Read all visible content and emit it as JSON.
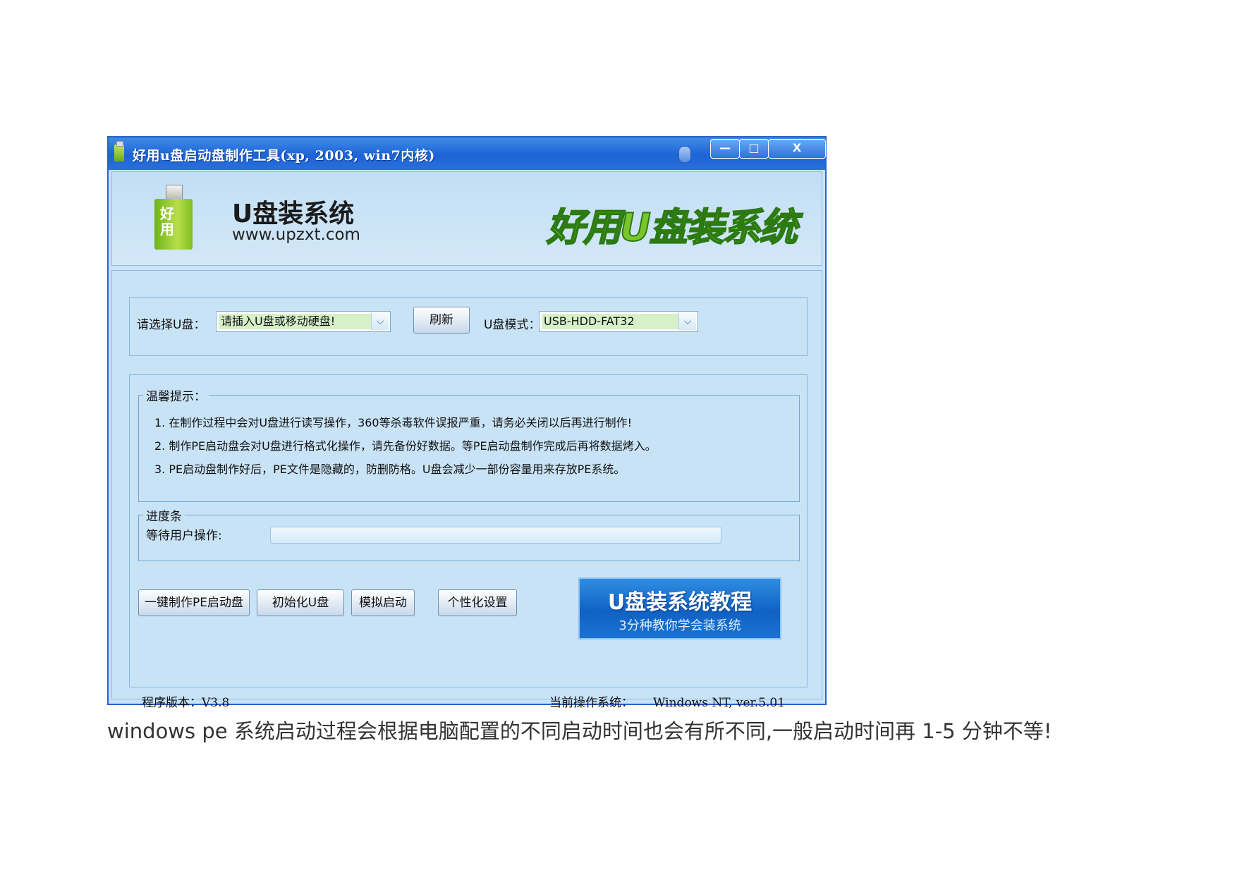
{
  "window": {
    "title": "好用u盘启动盘制作工具(xp, 2003, win7内核)",
    "min_label": "—",
    "max_label": "□",
    "close_label": "X"
  },
  "header": {
    "logo_text": "好用",
    "brand_name": "U盘装系统",
    "brand_url": "www.upzxt.com",
    "slogan": "好用U盘装系统"
  },
  "select": {
    "disk_label": "请选择U盘：",
    "disk_value": "请插入U盘或移动硬盘!",
    "refresh_label": "刷新",
    "mode_label": "U盘模式：",
    "mode_value": "USB-HDD-FAT32"
  },
  "tips": {
    "title": "温馨提示：",
    "items": [
      "1. 在制作过程中会对U盘进行读写操作，360等杀毒软件误报严重，请务必关闭以后再进行制作!",
      "2. 制作PE启动盘会对U盘进行格式化操作，请先备份好数据。等PE启动盘制作完成后再将数据烤入。",
      "3. PE启动盘制作好后，PE文件是隐藏的，防删防格。U盘会减少一部份容量用来存放PE系统。"
    ]
  },
  "progress": {
    "title": "进度条",
    "status": "等待用户操作:",
    "value": 0
  },
  "actions": {
    "make_pe": "一键制作PE启动盘",
    "init": "初始化U盘",
    "simulate": "模拟启动",
    "personalize": "个性化设置"
  },
  "tutorial": {
    "title": "U盘装系统教程",
    "subtitle": "3分种教你学会装系统"
  },
  "footer": {
    "version_label": "程序版本：",
    "version_value": "V3.8",
    "os_label": "当前操作系统：",
    "os_value": "Windows NT, ver.5.01"
  },
  "caption": "windows pe 系统启动过程会根据电脑配置的不同启动时间也会有所不同,一般启动时间再 1-5 分钟不等!"
}
